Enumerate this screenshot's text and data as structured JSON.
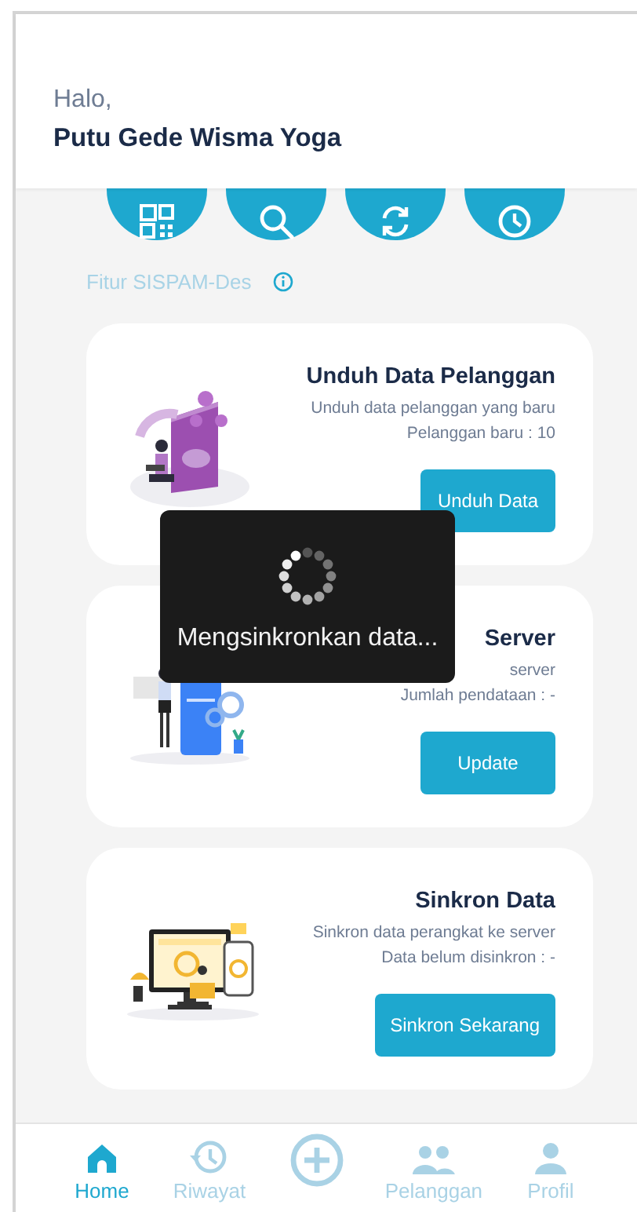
{
  "greeting": "Halo,",
  "user_name": "Putu Gede Wisma Yoga",
  "quick_actions": [
    {
      "kind": "qr"
    },
    {
      "kind": "search"
    },
    {
      "kind": "sync"
    },
    {
      "kind": "history"
    }
  ],
  "section": {
    "title": "Fitur SISPAM-Des"
  },
  "cards": [
    {
      "kind": "download",
      "title": "Unduh Data Pelanggan",
      "description": "Unduh data pelanggan yang baru",
      "stat": "Pelanggan baru : 10",
      "button": "Unduh Data"
    },
    {
      "kind": "update",
      "title": "Server",
      "description": "server",
      "stat": "Jumlah pendataan : -",
      "button": "Update"
    },
    {
      "kind": "sync",
      "title": "Sinkron Data",
      "description": "Sinkron data perangkat ke server",
      "stat": "Data belum disinkron : -",
      "button": "Sinkron Sekarang"
    }
  ],
  "toast": {
    "message": "Mengsinkronkan data..."
  },
  "nav": [
    {
      "kind": "home",
      "label": "Home",
      "selected": true
    },
    {
      "kind": "history",
      "label": "Riwayat",
      "selected": false
    },
    {
      "kind": "add",
      "selected": false
    },
    {
      "kind": "people",
      "label": "Pelanggan",
      "selected": false
    },
    {
      "kind": "person",
      "label": "Profil",
      "selected": false
    }
  ]
}
